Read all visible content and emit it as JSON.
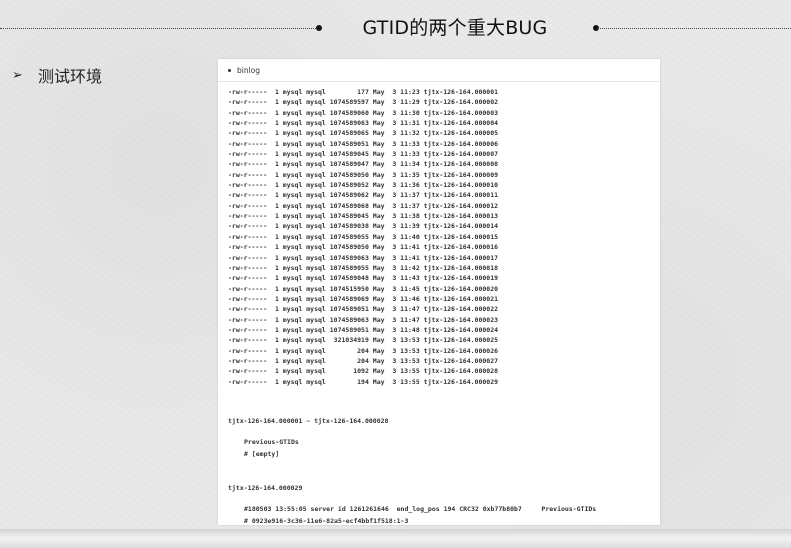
{
  "slide": {
    "title": "GTID的两个重大BUG",
    "bullet_marker": "➢",
    "bullet_text": "测试环境"
  },
  "doc": {
    "header": "binlog",
    "listing": [
      "-rw-r-----  1 mysql mysql        177 May  3 11:23 tjtx-126-164.000001",
      "-rw-r-----  1 mysql mysql 1074589597 May  3 11:29 tjtx-126-164.000002",
      "-rw-r-----  1 mysql mysql 1074589060 May  3 11:30 tjtx-126-164.000003",
      "-rw-r-----  1 mysql mysql 1074589063 May  3 11:31 tjtx-126-164.000004",
      "-rw-r-----  1 mysql mysql 1074589065 May  3 11:32 tjtx-126-164.000005",
      "-rw-r-----  1 mysql mysql 1074589051 May  3 11:33 tjtx-126-164.000006",
      "-rw-r-----  1 mysql mysql 1074589045 May  3 11:33 tjtx-126-164.000007",
      "-rw-r-----  1 mysql mysql 1074589047 May  3 11:34 tjtx-126-164.000008",
      "-rw-r-----  1 mysql mysql 1074589050 May  3 11:35 tjtx-126-164.000009",
      "-rw-r-----  1 mysql mysql 1074589052 May  3 11:36 tjtx-126-164.000010",
      "-rw-r-----  1 mysql mysql 1074589062 May  3 11:37 tjtx-126-164.000011",
      "-rw-r-----  1 mysql mysql 1074589068 May  3 11:37 tjtx-126-164.000012",
      "-rw-r-----  1 mysql mysql 1074589045 May  3 11:38 tjtx-126-164.000013",
      "-rw-r-----  1 mysql mysql 1074589038 May  3 11:39 tjtx-126-164.000014",
      "-rw-r-----  1 mysql mysql 1074589055 May  3 11:40 tjtx-126-164.000015",
      "-rw-r-----  1 mysql mysql 1074589050 May  3 11:41 tjtx-126-164.000016",
      "-rw-r-----  1 mysql mysql 1074589063 May  3 11:41 tjtx-126-164.000017",
      "-rw-r-----  1 mysql mysql 1074589055 May  3 11:42 tjtx-126-164.000018",
      "-rw-r-----  1 mysql mysql 1074589048 May  3 11:43 tjtx-126-164.000019",
      "-rw-r-----  1 mysql mysql 1074515950 May  3 11:45 tjtx-126-164.000020",
      "-rw-r-----  1 mysql mysql 1074589069 May  3 11:46 tjtx-126-164.000021",
      "-rw-r-----  1 mysql mysql 1074589051 May  3 11:47 tjtx-126-164.000022",
      "-rw-r-----  1 mysql mysql 1074589063 May  3 11:47 tjtx-126-164.000023",
      "-rw-r-----  1 mysql mysql 1074589051 May  3 11:48 tjtx-126-164.000024",
      "-rw-r-----  1 mysql mysql  321034919 May  3 13:53 tjtx-126-164.000025",
      "-rw-r-----  1 mysql mysql        204 May  3 13:53 tjtx-126-164.000026",
      "-rw-r-----  1 mysql mysql        204 May  3 13:53 tjtx-126-164.000027",
      "-rw-r-----  1 mysql mysql       1092 May  3 13:55 tjtx-126-164.000028",
      "-rw-r-----  1 mysql mysql        194 May  3 13:55 tjtx-126-164.000029"
    ],
    "range_line": "tjtx-126-164.000001 ~ tjtx-126-164.000028",
    "range_info1": "Previous-GTIDs",
    "range_info2": "# [empty]",
    "file2_line": "tjtx-126-164.000029",
    "file2_info1": "#180503 13:55:05 server id 1261261646  end_log_pos 194 CRC32 0xb77b80b7     Previous-GTIDs",
    "file2_info2": "# 0923e916-3c36-11e6-82a5-ecf4bbf1f518:1-3"
  },
  "colors": {
    "background": "#e9e9e9",
    "doc_background": "#ffffff",
    "text": "#333333"
  }
}
